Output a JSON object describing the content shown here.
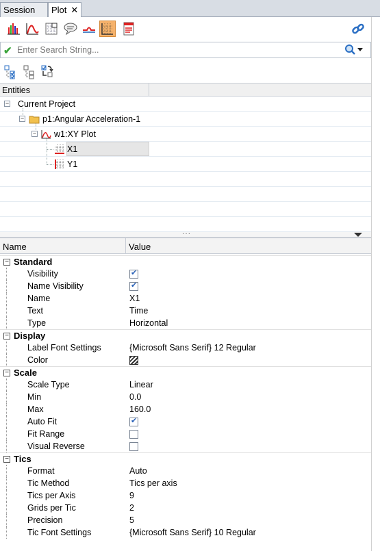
{
  "tabs": [
    {
      "label": "Session",
      "active": false
    },
    {
      "label": "Plot",
      "active": true,
      "close": "✕"
    }
  ],
  "toolbar": {
    "icons": [
      "bar-chart-icon",
      "curve-icon",
      "axis-grid-icon",
      "note-bubble-icon",
      "curve-line-icon",
      "axis-icon",
      "legend-icon",
      "link-icon"
    ],
    "pressed": "axis-icon"
  },
  "search": {
    "placeholder": "Enter Search String..."
  },
  "entities": {
    "header": "Entities",
    "tree": [
      {
        "label": "Current Project",
        "level": 0
      },
      {
        "label": "p1:Angular Acceleration-1",
        "level": 1
      },
      {
        "label": "w1:XY Plot",
        "level": 2
      },
      {
        "label": "X1",
        "level": 3,
        "selected": true
      },
      {
        "label": "Y1",
        "level": 3
      }
    ]
  },
  "splitter": {
    "grip": "···"
  },
  "grid": {
    "col_name": "Name",
    "col_value": "Value",
    "categories": [
      {
        "label": "Standard",
        "rows": [
          {
            "name": "Visibility",
            "type": "checkbox",
            "checked": true
          },
          {
            "name": "Name Visibility",
            "type": "checkbox",
            "checked": true
          },
          {
            "name": "Name",
            "type": "text",
            "value": "X1"
          },
          {
            "name": "Text",
            "type": "text",
            "value": "Time"
          },
          {
            "name": "Type",
            "type": "text",
            "value": "Horizontal"
          }
        ]
      },
      {
        "label": "Display",
        "rows": [
          {
            "name": "Label Font Settings",
            "type": "text",
            "value": "{Microsoft Sans Serif} 12 Regular"
          },
          {
            "name": "Color",
            "type": "swatch",
            "value": ""
          }
        ]
      },
      {
        "label": "Scale",
        "rows": [
          {
            "name": "Scale Type",
            "type": "text",
            "value": "Linear"
          },
          {
            "name": "Min",
            "type": "text",
            "value": "0.0"
          },
          {
            "name": "Max",
            "type": "text",
            "value": "160.0"
          },
          {
            "name": "Auto Fit",
            "type": "checkbox",
            "checked": true
          },
          {
            "name": "Fit Range",
            "type": "checkbox",
            "checked": false
          },
          {
            "name": "Visual Reverse",
            "type": "checkbox",
            "checked": false
          }
        ]
      },
      {
        "label": "Tics",
        "rows": [
          {
            "name": "Format",
            "type": "text",
            "value": "Auto"
          },
          {
            "name": "Tic Method",
            "type": "text",
            "value": "Tics per axis"
          },
          {
            "name": "Tics per Axis",
            "type": "text",
            "value": "9"
          },
          {
            "name": "Grids per Tic",
            "type": "text",
            "value": "2"
          },
          {
            "name": "Precision",
            "type": "text",
            "value": "5"
          },
          {
            "name": "Tic Font Settings",
            "type": "text",
            "value": "{Microsoft Sans Serif} 10 Regular"
          }
        ]
      }
    ]
  },
  "colors": {
    "accent_pressed": "#f6b26b",
    "check_blue": "#2a62b8",
    "search_check": "#3aa43a"
  }
}
